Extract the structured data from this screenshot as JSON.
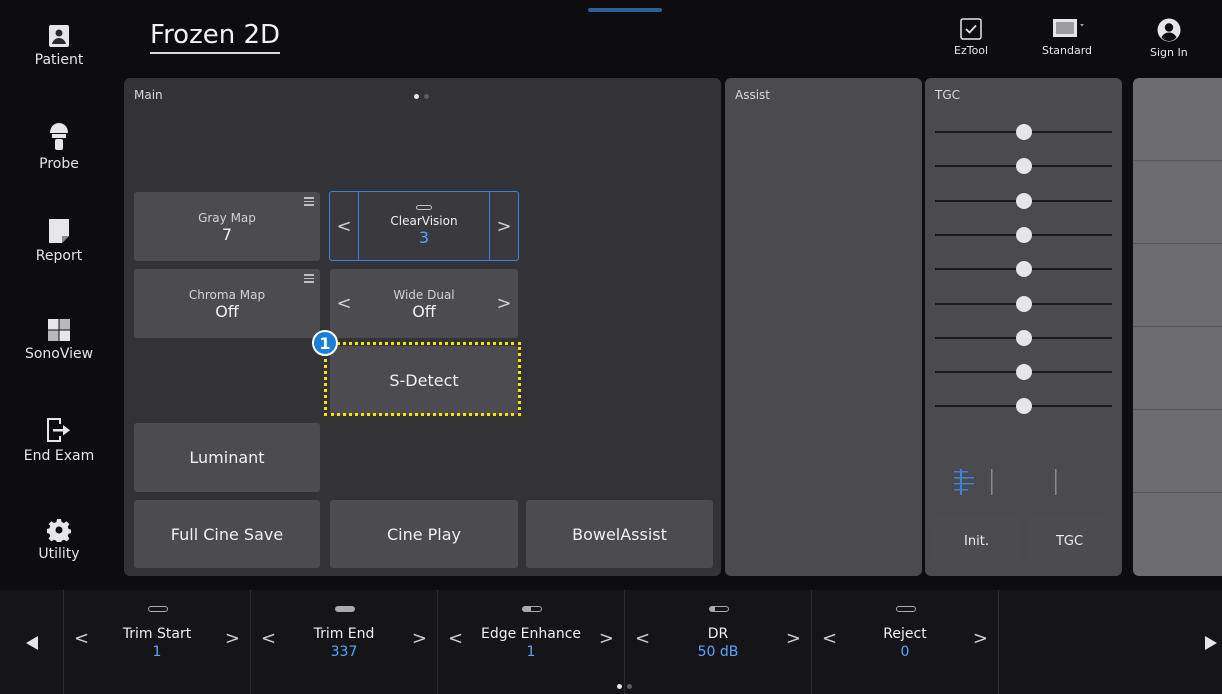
{
  "nav": {
    "patient": "Patient",
    "probe": "Probe",
    "report": "Report",
    "sonoview": "SonoView",
    "end_exam": "End Exam",
    "utility": "Utility"
  },
  "title": "Frozen 2D",
  "top_right": {
    "eztool": "EzTool",
    "standard": "Standard",
    "sign_in": "Sign In"
  },
  "main": {
    "title": "Main",
    "gray_map": {
      "label": "Gray Map",
      "value": "7"
    },
    "clearvision": {
      "label": "ClearVision",
      "value": "3"
    },
    "chroma_map": {
      "label": "Chroma Map",
      "value": "Off"
    },
    "wide_dual": {
      "label": "Wide Dual",
      "value": "Off"
    },
    "s_detect": "S-Detect",
    "luminant": "Luminant",
    "full_cine_save": "Full Cine Save",
    "cine_play": "Cine Play",
    "bowel_assist": "BowelAssist",
    "callout_number": "1"
  },
  "assist": {
    "title": "Assist"
  },
  "tgc": {
    "title": "TGC",
    "init_label": "Init.",
    "tgc_label": "TGC",
    "slider_levels": [
      0.5,
      0.5,
      0.5,
      0.5,
      0.5,
      0.5,
      0.5,
      0.5,
      0.5
    ]
  },
  "bottom": {
    "controls": [
      {
        "label": "Trim Start",
        "value": "1"
      },
      {
        "label": "Trim End",
        "value": "337"
      },
      {
        "label": "Edge Enhance",
        "value": "1"
      },
      {
        "label": "DR",
        "value": "50 dB"
      },
      {
        "label": "Reject",
        "value": "0"
      }
    ]
  },
  "colors": {
    "accent_blue": "#5aa4ff",
    "callout_yellow": "#f2e600",
    "panel": "#333337"
  }
}
